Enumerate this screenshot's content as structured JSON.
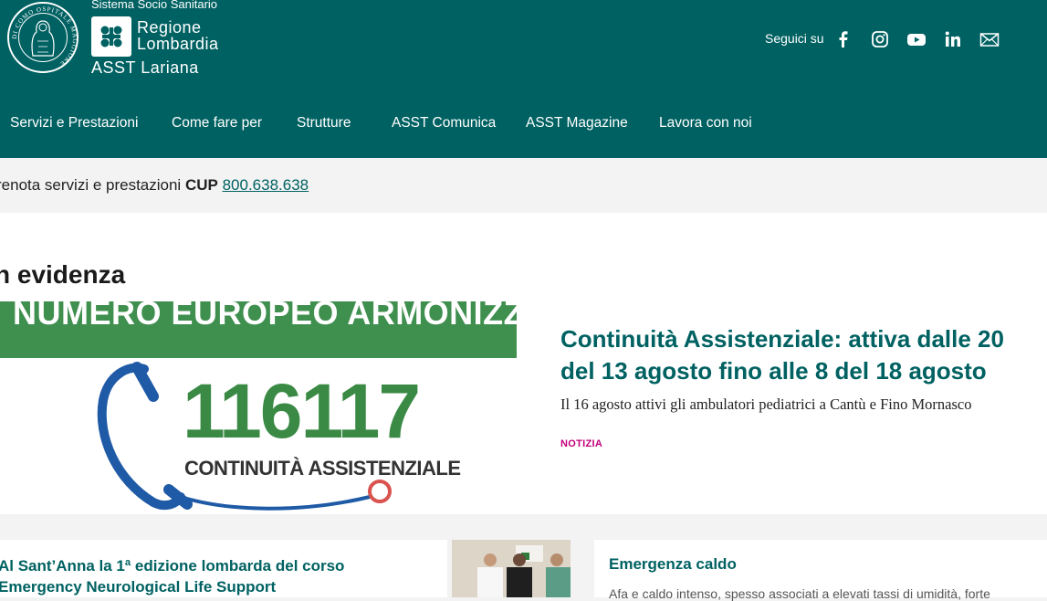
{
  "header": {
    "seal_text": "DI COMO OSPITALE MAGGIORE",
    "sistema": "Sistema Socio Sanitario",
    "regione_line1": "Regione",
    "regione_line2": "Lombardia",
    "asst": "ASST Lariana",
    "seguici": "Seguici su",
    "social_icons": [
      "facebook-icon",
      "instagram-icon",
      "youtube-icon",
      "linkedin-icon",
      "mail-icon"
    ],
    "bg_color": "#006162"
  },
  "nav": {
    "items": [
      {
        "label": "Servizi e Prestazioni"
      },
      {
        "label": "Come fare per"
      },
      {
        "label": "Strutture"
      },
      {
        "label": "ASST Comunica"
      },
      {
        "label": "ASST Magazine"
      },
      {
        "label": "Lavora con noi"
      }
    ]
  },
  "cup": {
    "text": "renota servizi e prestazioni ",
    "bold": "CUP",
    "phone": "800.638.638"
  },
  "evidenza": {
    "heading": "n evidenza",
    "promo_band": "NUMERO EUROPEO ARMONIZZATO",
    "promo_number": "116117",
    "promo_caption": "CONTINUITÀ ASSISTENZIALE",
    "title": "Continuità Assistenziale: attiva dalle 20 del 13 agosto fino alle 8 del 18 agosto",
    "subtitle": "Il 16 agosto attivi gli ambulatori pediatrici a Cantù e Fino Mornasco",
    "tag": "NOTIZIA",
    "accent_color": "#c0007a"
  },
  "news": [
    {
      "title": "Al Sant’Anna la 1ª edizione lombarda del corso Emergency Neurological Life Support"
    },
    {
      "title": "Emergenza caldo",
      "text": "Afa e caldo intenso, spesso associati a elevati tassi di umidità, forte"
    }
  ]
}
